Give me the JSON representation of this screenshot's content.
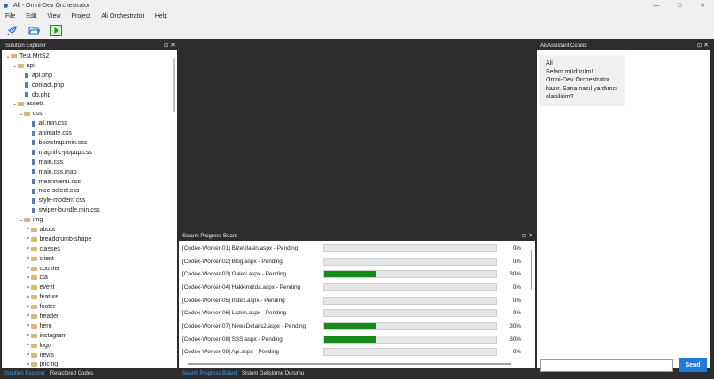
{
  "window": {
    "title": "Ali - Omni-Dev Orchestrator"
  },
  "window_controls": [
    "—",
    "□",
    "✕"
  ],
  "menu": [
    "File",
    "Edit",
    "View",
    "Project",
    "Ali Orchestrator",
    "Help"
  ],
  "toolbar": {
    "icons": [
      "rocket-icon",
      "open-folder-icon",
      "run-icon"
    ]
  },
  "solution_explorer": {
    "title": "Solution Explorer",
    "tree": [
      {
        "depth": 0,
        "type": "folder",
        "expanded": true,
        "label": "Test.MrtS2"
      },
      {
        "depth": 1,
        "type": "folder",
        "expanded": true,
        "label": "api"
      },
      {
        "depth": 2,
        "type": "file",
        "label": "api.php"
      },
      {
        "depth": 2,
        "type": "file",
        "label": "contact.php"
      },
      {
        "depth": 2,
        "type": "file",
        "label": "db.php"
      },
      {
        "depth": 1,
        "type": "folder",
        "expanded": true,
        "label": "assets"
      },
      {
        "depth": 2,
        "type": "folder",
        "expanded": true,
        "label": "css"
      },
      {
        "depth": 3,
        "type": "file",
        "label": "all.min.css"
      },
      {
        "depth": 3,
        "type": "file",
        "label": "animate.css"
      },
      {
        "depth": 3,
        "type": "file",
        "label": "bootstrap.min.css"
      },
      {
        "depth": 3,
        "type": "file",
        "label": "magnific-popup.css"
      },
      {
        "depth": 3,
        "type": "file",
        "label": "main.css"
      },
      {
        "depth": 3,
        "type": "file",
        "label": "main.css.map"
      },
      {
        "depth": 3,
        "type": "file",
        "label": "meanmenu.css"
      },
      {
        "depth": 3,
        "type": "file",
        "label": "nice-select.css"
      },
      {
        "depth": 3,
        "type": "file",
        "label": "style-modern.css"
      },
      {
        "depth": 3,
        "type": "file",
        "label": "swiper-bundle.min.css"
      },
      {
        "depth": 2,
        "type": "folder",
        "expanded": true,
        "label": "img"
      },
      {
        "depth": 3,
        "type": "folder",
        "expanded": false,
        "label": "about"
      },
      {
        "depth": 3,
        "type": "folder",
        "expanded": false,
        "label": "breadcrumb-shape"
      },
      {
        "depth": 3,
        "type": "folder",
        "expanded": false,
        "label": "classes"
      },
      {
        "depth": 3,
        "type": "folder",
        "expanded": false,
        "label": "client"
      },
      {
        "depth": 3,
        "type": "folder",
        "expanded": false,
        "label": "counter"
      },
      {
        "depth": 3,
        "type": "folder",
        "expanded": false,
        "label": "cta"
      },
      {
        "depth": 3,
        "type": "folder",
        "expanded": false,
        "label": "event"
      },
      {
        "depth": 3,
        "type": "folder",
        "expanded": false,
        "label": "feature"
      },
      {
        "depth": 3,
        "type": "folder",
        "expanded": false,
        "label": "footer"
      },
      {
        "depth": 3,
        "type": "folder",
        "expanded": false,
        "label": "header"
      },
      {
        "depth": 3,
        "type": "folder",
        "expanded": false,
        "label": "hero"
      },
      {
        "depth": 3,
        "type": "folder",
        "expanded": false,
        "label": "instagram"
      },
      {
        "depth": 3,
        "type": "folder",
        "expanded": false,
        "label": "logo"
      },
      {
        "depth": 3,
        "type": "folder",
        "expanded": false,
        "label": "news"
      },
      {
        "depth": 3,
        "type": "folder",
        "expanded": false,
        "label": "pricing"
      }
    ],
    "tabs": {
      "active": "Solution Explorer",
      "inactive": "Refactored Codes"
    }
  },
  "swarm": {
    "title": "Swarm Progress Board",
    "rows": [
      {
        "label": "[Codex-Worker-01] BizeUlasin.aspx - Pending",
        "progress": 0,
        "pct": "0%"
      },
      {
        "label": "[Codex-Worker-02] Blog.aspx - Pending",
        "progress": 0,
        "pct": "0%"
      },
      {
        "label": "[Codex-Worker-03] Galeri.aspx - Pending",
        "progress": 30,
        "pct": "30%"
      },
      {
        "label": "[Codex-Worker-04] Hakkimizda.aspx - Pending",
        "progress": 0,
        "pct": "0%"
      },
      {
        "label": "[Codex-Worker-05] Index.aspx - Pending",
        "progress": 0,
        "pct": "0%"
      },
      {
        "label": "[Codex-Worker-06] Lazim.aspx - Pending",
        "progress": 0,
        "pct": "0%"
      },
      {
        "label": "[Codex-Worker-07] NewsDetails2.aspx - Pending",
        "progress": 30,
        "pct": "30%"
      },
      {
        "label": "[Codex-Worker-08] SSS.aspx - Pending",
        "progress": 30,
        "pct": "30%"
      },
      {
        "label": "[Codex-Worker-09] Api.aspx - Pending",
        "progress": 0,
        "pct": "0%"
      }
    ],
    "tabs": {
      "active": "Swarm Progress Board",
      "inactive": "Sistem Geliştirme Durumu"
    },
    "colors": {
      "fill": "#178b17"
    }
  },
  "copilot": {
    "title": "Ali Assistant Copilot",
    "message": {
      "sender": "Ali",
      "lines": [
        "Selam müdürüm!",
        "Omni-Dev Orchestrator",
        "hazır. Sana nasıl yardımcı",
        "olabilirim?"
      ]
    },
    "input_value": "",
    "send_label": "Send"
  },
  "panel_glyphs": {
    "pin": "⊡",
    "close": "✕"
  }
}
